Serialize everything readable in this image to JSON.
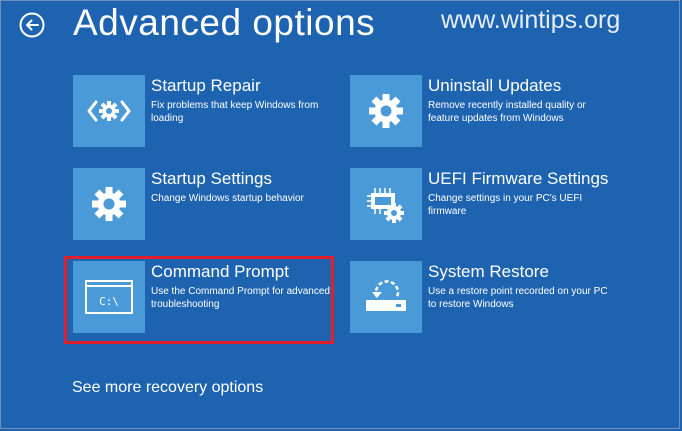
{
  "page": {
    "title": "Advanced options",
    "watermark": "www.wintips.org",
    "more_link": "See more recovery options"
  },
  "colors": {
    "background": "#1e63b0",
    "tile_icon": "#4b9ad8",
    "highlight": "#e1202b"
  },
  "tiles": [
    {
      "title": "Startup Repair",
      "desc": "Fix problems that keep Windows from loading",
      "icon": "startup-repair-icon"
    },
    {
      "title": "Uninstall Updates",
      "desc": "Remove recently installed quality or feature updates from Windows",
      "icon": "gear-icon"
    },
    {
      "title": "Startup Settings",
      "desc": "Change Windows startup behavior",
      "icon": "gear-icon"
    },
    {
      "title": "UEFI Firmware Settings",
      "desc": "Change settings in your PC's UEFI firmware",
      "icon": "firmware-chip-icon"
    },
    {
      "title": "Command Prompt",
      "desc": "Use the Command Prompt for advanced troubleshooting",
      "icon": "command-prompt-icon",
      "cmd_text": "C:\\"
    },
    {
      "title": "System Restore",
      "desc": "Use a restore point recorded on your PC to restore Windows",
      "icon": "system-restore-icon"
    }
  ]
}
